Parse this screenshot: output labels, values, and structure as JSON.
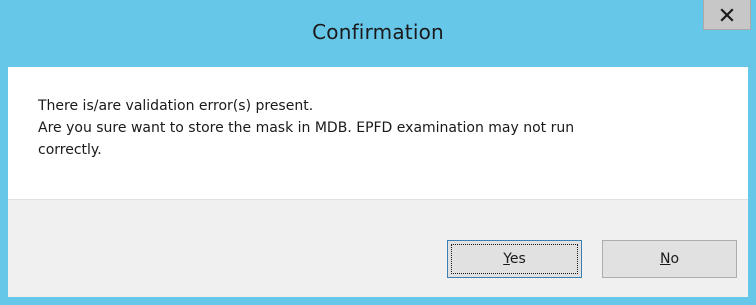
{
  "dialog": {
    "title": "Confirmation",
    "close_icon": "close-icon",
    "message_lines": [
      "There is/are validation error(s) present.",
      "Are you sure want to store the mask in MDB. EPFD examination may not run",
      "correctly."
    ],
    "buttons": {
      "yes": {
        "accel": "Y",
        "rest": "es"
      },
      "no": {
        "accel": "N",
        "rest": "o"
      }
    }
  },
  "colors": {
    "titlebar": "#67c7e9",
    "close_button": "#c7c7c7",
    "footer": "#f0f0f0",
    "default_button_border": "#3c7fb1"
  }
}
